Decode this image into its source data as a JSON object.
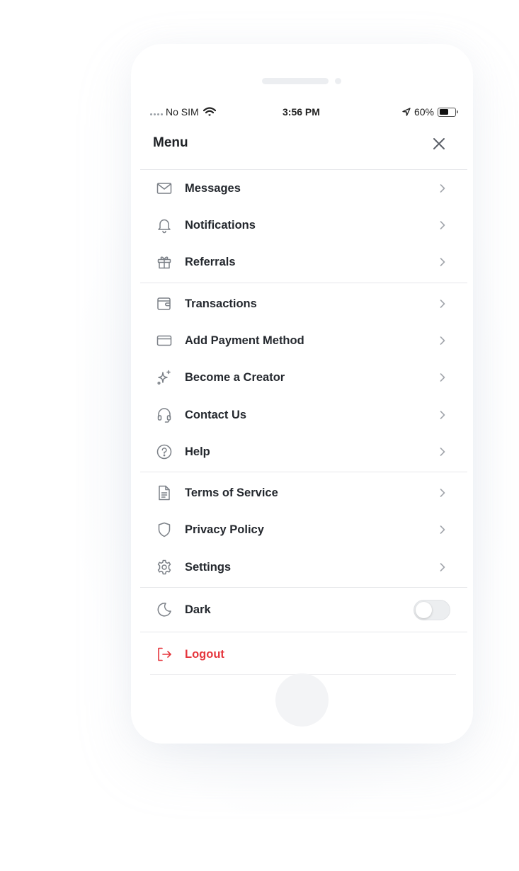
{
  "status_bar": {
    "carrier": "No SIM",
    "time": "3:56 PM",
    "battery_percent": "60%",
    "battery_level": 0.6,
    "icons": [
      "signal-dots-icon",
      "wifi-icon",
      "location-arrow-icon",
      "battery-icon"
    ]
  },
  "menu": {
    "title": "Menu",
    "close_icon": "close-icon"
  },
  "sections": [
    {
      "items": [
        {
          "label": "Messages",
          "icon": "mail-icon"
        },
        {
          "label": "Notifications",
          "icon": "bell-icon"
        },
        {
          "label": "Referrals",
          "icon": "gift-icon"
        }
      ]
    },
    {
      "items": [
        {
          "label": "Transactions",
          "icon": "wallet-icon"
        },
        {
          "label": "Add Payment Method",
          "icon": "credit-card-icon"
        },
        {
          "label": "Become a Creator",
          "icon": "sparkles-icon"
        },
        {
          "label": "Contact Us",
          "icon": "headset-icon"
        },
        {
          "label": "Help",
          "icon": "help-circle-icon"
        }
      ]
    },
    {
      "items": [
        {
          "label": "Terms of Service",
          "icon": "document-icon"
        },
        {
          "label": "Privacy Policy",
          "icon": "shield-icon"
        },
        {
          "label": "Settings",
          "icon": "gear-icon"
        }
      ]
    }
  ],
  "dark_mode": {
    "label": "Dark",
    "icon": "moon-icon",
    "enabled": false
  },
  "logout": {
    "label": "Logout",
    "icon": "logout-icon",
    "color": "#e5363d"
  },
  "colors": {
    "text": "#24282e",
    "icon": "#7b8087",
    "chevron": "#a3a7ad",
    "divider": "#e6e7ea",
    "danger": "#e5363d"
  }
}
